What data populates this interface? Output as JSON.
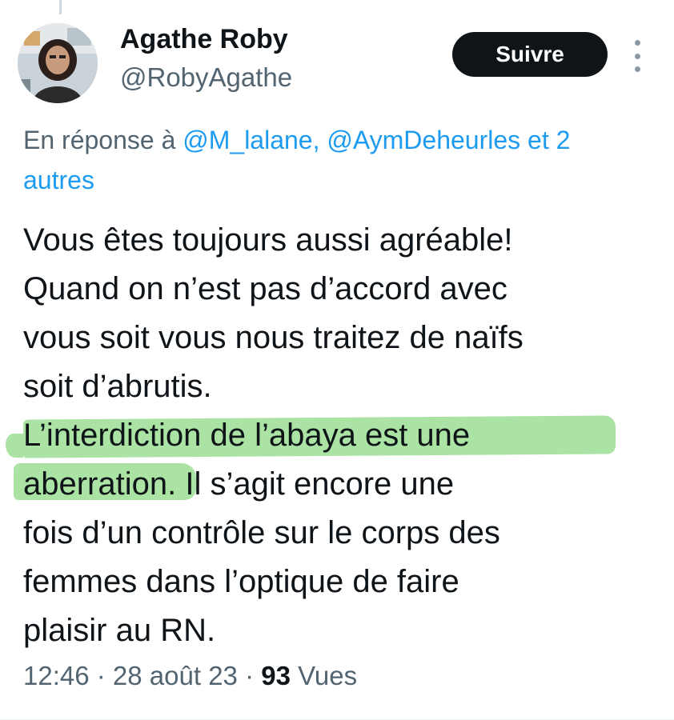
{
  "author": {
    "name": "Agathe Roby",
    "handle": "@RobyAgathe"
  },
  "follow_button": {
    "label": "Suivre"
  },
  "more_menu": {
    "icon": "more-vertical-icon"
  },
  "reply_context": {
    "prefix": "En réponse à ",
    "mentions": "@M_lalane, @AymDeheurles et 2",
    "others": "autres"
  },
  "tweet": {
    "lines": [
      "Vous êtes toujours aussi agréable!",
      "Quand on n’est pas d’accord avec",
      "vous soit vous nous traitez de naïfs",
      "soit d’abrutis.",
      "L’interdiction de l’abaya est une",
      "aberration. Il s’agit encore une",
      "fois d’un contrôle sur le corps des",
      "femmes dans l’optique de faire",
      "plaisir au RN."
    ],
    "highlight_color": "#89d880"
  },
  "meta": {
    "time": "12:46",
    "separator": " · ",
    "date": "28 août 23",
    "views_count": "93",
    "views_label": " Vues"
  },
  "colors": {
    "text_primary": "#0f1419",
    "text_secondary": "#536471",
    "link": "#1d9bf0",
    "button_bg": "#0f1419"
  }
}
